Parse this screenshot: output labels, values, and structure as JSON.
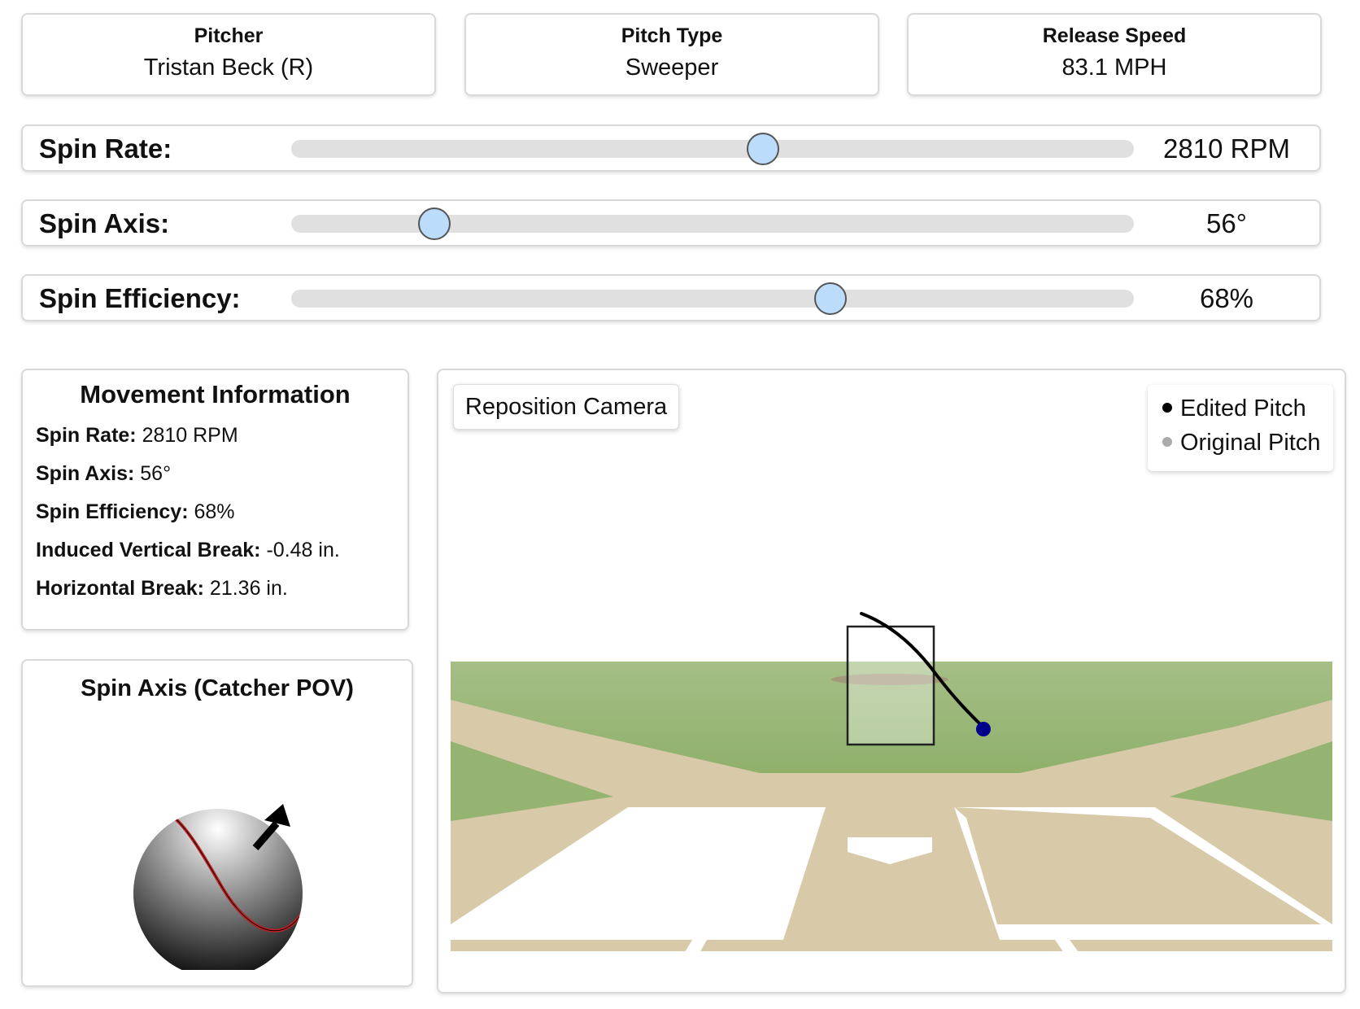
{
  "header": {
    "pitcher": {
      "label": "Pitcher",
      "value": "Tristan Beck (R)"
    },
    "pitch_type": {
      "label": "Pitch Type",
      "value": "Sweeper"
    },
    "release_speed": {
      "label": "Release Speed",
      "value": "83.1 MPH"
    }
  },
  "sliders": {
    "spin_rate": {
      "label": "Spin Rate:",
      "value_text": "2810 RPM",
      "position": 0.56
    },
    "spin_axis": {
      "label": "Spin Axis:",
      "value_text": "56°",
      "position": 0.17
    },
    "spin_efficiency": {
      "label": "Spin Efficiency:",
      "value_text": "68%",
      "position": 0.64
    }
  },
  "movement": {
    "title": "Movement Information",
    "rows": [
      {
        "key": "Spin Rate:",
        "value": " 2810 RPM"
      },
      {
        "key": "Spin Axis:",
        "value": " 56°"
      },
      {
        "key": "Spin Efficiency:",
        "value": " 68%"
      },
      {
        "key": "Induced Vertical Break:",
        "value": " -0.48 in."
      },
      {
        "key": "Horizontal Break:",
        "value": " 21.36 in."
      }
    ]
  },
  "spin_axis_panel": {
    "title": "Spin Axis (Catcher POV)"
  },
  "field_view": {
    "reposition_button": "Reposition Camera",
    "legend": [
      {
        "label": "Edited Pitch",
        "color": "#000000"
      },
      {
        "label": "Original Pitch",
        "color": "#aaaaaa"
      }
    ]
  },
  "colors": {
    "slider_thumb": "#bcdcfb",
    "grass": "#98b776",
    "dirt": "#d8c9a9",
    "ball_marker": "#00008b",
    "seam": "#c41e1e"
  }
}
